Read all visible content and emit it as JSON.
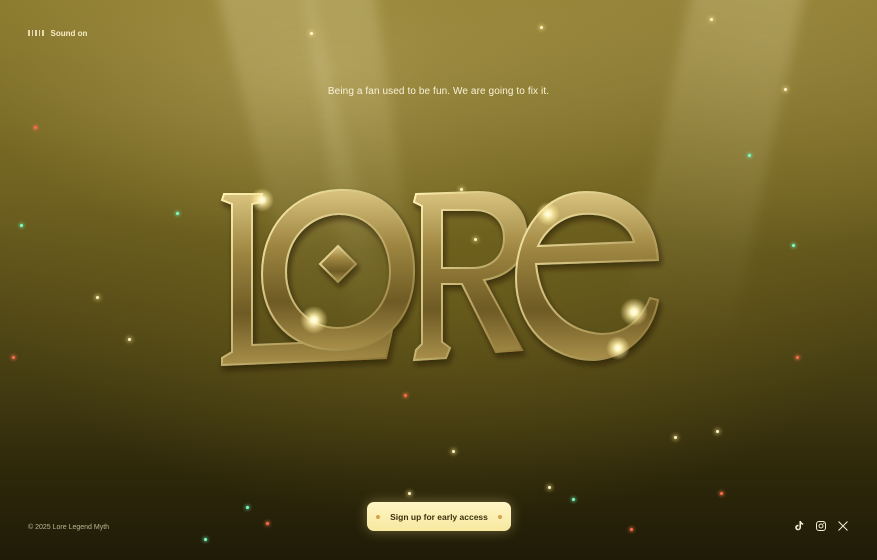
{
  "sound": {
    "label": "Sound on",
    "icon": "sound-bars-icon"
  },
  "hero": {
    "tagline": "Being a fan used to be fun. We are going to fix it.",
    "logo_text": "LORE",
    "logo_colors": {
      "gold_light": "#f4e2a0",
      "gold_mid": "#b79a48",
      "gold_dark": "#5c4a1c",
      "glow": "#fff3b0"
    }
  },
  "cta": {
    "label": "Sign up for early access",
    "background": "#fff3b8",
    "dot_color": "#d9a34a"
  },
  "footer": {
    "copyright": "© 2025 Lore Legend Myth",
    "socials": [
      {
        "name": "TikTok",
        "icon": "tiktok-icon"
      },
      {
        "name": "Instagram",
        "icon": "instagram-icon"
      },
      {
        "name": "X",
        "icon": "x-icon"
      }
    ]
  }
}
